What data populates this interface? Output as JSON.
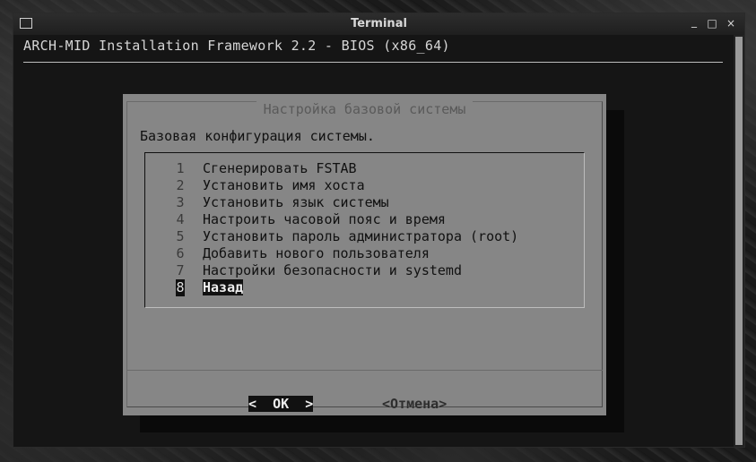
{
  "window": {
    "title": "Terminal",
    "min_glyph": "_",
    "max_glyph": "□",
    "close_glyph": "×"
  },
  "terminal": {
    "heading": "ARCH-MID Installation Framework 2.2 - BIOS (x86_64)"
  },
  "dialog": {
    "title": "Настройка базовой системы",
    "prompt": "Базовая конфигурация системы.",
    "menu": [
      {
        "num": "1",
        "label": "Сгенерировать FSTAB"
      },
      {
        "num": "2",
        "label": "Установить имя хоста"
      },
      {
        "num": "3",
        "label": "Установить язык системы"
      },
      {
        "num": "4",
        "label": "Настроить часовой пояс и время"
      },
      {
        "num": "5",
        "label": "Установить пароль администратора (root)"
      },
      {
        "num": "6",
        "label": "Добавить нового пользователя"
      },
      {
        "num": "7",
        "label": "Настройки безопасности и systemd"
      },
      {
        "num": "8",
        "label": "Назад"
      }
    ],
    "selected_index": 7,
    "ok_button": "<  OK  >",
    "cancel_button": "<Отмена>"
  },
  "colors": {
    "dialog_bg": "#868686",
    "terminal_bg": "#151515",
    "selection_bg": "#111111"
  }
}
